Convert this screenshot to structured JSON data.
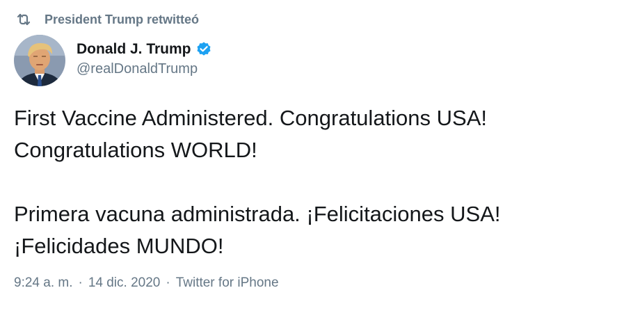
{
  "retweet": {
    "icon": "retweet-icon",
    "label": "President Trump retwitteó"
  },
  "author": {
    "avatar_icon": "avatar-portrait",
    "name": "Donald J. Trump",
    "verified_icon": "verified-badge-icon",
    "handle": "@realDonaldTrump"
  },
  "tweet": {
    "line1": "First Vaccine Administered. Congratulations USA!",
    "line2": "Congratulations WORLD!",
    "line3": "Primera vacuna administrada. ¡Felicitaciones USA!",
    "line4": "¡Felicidades MUNDO!"
  },
  "meta": {
    "time": "9:24 a. m.",
    "separator": "·",
    "date": "14 dic. 2020",
    "source": "Twitter for iPhone"
  },
  "colors": {
    "text": "#14171a",
    "secondary": "#657786",
    "verified": "#1da1f2"
  }
}
